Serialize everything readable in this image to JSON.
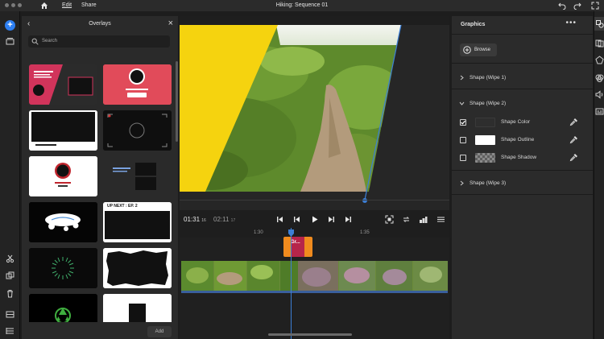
{
  "menubar": {
    "items": [
      "Edit",
      "Share"
    ],
    "title": "Hiking: Sequence 01",
    "icons": [
      "home-icon",
      "undo-icon",
      "redo-icon",
      "fullscreen-icon"
    ]
  },
  "left_rail": {
    "icons": [
      "add-icon",
      "media-icon",
      "cut-icon",
      "duplicate-icon",
      "trash-icon",
      "split-icon",
      "list-icon"
    ]
  },
  "overlays": {
    "title": "Overlays",
    "search_placeholder": "Search",
    "add_label": "Add",
    "tiles": [
      {
        "label": "Subscribe layout",
        "text": "",
        "accent": "#d1345b"
      },
      {
        "label": "Subscribe card",
        "text": "",
        "accent": "#e14b5a"
      },
      {
        "label": "Wide frame",
        "text": "",
        "accent": "#ffffff"
      },
      {
        "label": "Corner frame",
        "text": "",
        "accent": "#333333"
      },
      {
        "label": "Circle subscribe",
        "text": "",
        "accent": "#ffffff"
      },
      {
        "label": "Split screen",
        "text": "",
        "accent": "#2a2a2a"
      },
      {
        "label": "Logo splash",
        "text": "",
        "accent": "#000000"
      },
      {
        "label": "Up next",
        "text": "UP NEXT : EP. 2",
        "accent": "#ffffff"
      },
      {
        "label": "Radial burst",
        "text": "",
        "accent": "#0a0a0a"
      },
      {
        "label": "Torn paper",
        "text": "",
        "accent": "#ffffff"
      },
      {
        "label": "Recycle",
        "text": "",
        "accent": "#000000"
      },
      {
        "label": "Blank card",
        "text": "",
        "accent": "#ffffff"
      }
    ]
  },
  "player": {
    "current_time": "01:31",
    "current_frames": "16",
    "duration": "02:11",
    "duration_frames": "17",
    "controls": [
      "step-start-icon",
      "step-back-icon",
      "play-icon",
      "step-forward-icon",
      "step-end-icon"
    ],
    "right_controls": [
      "fit-icon",
      "loop-icon",
      "levels-icon",
      "menu-icon"
    ]
  },
  "timeline": {
    "ruler_ticks": [
      "1:30",
      "1:35"
    ],
    "graphic_clip_label": "Gr...",
    "playhead_time": "01:31:16"
  },
  "graphics_panel": {
    "title": "Graphics",
    "browse_label": "Browse",
    "sections": [
      {
        "label": "Shape (Wipe 1)",
        "expanded": false
      },
      {
        "label": "Shape (Wipe 2)",
        "expanded": true
      },
      {
        "label": "Shape (Wipe 3)",
        "expanded": false
      }
    ],
    "properties": [
      {
        "label": "Shape Color",
        "checked": true,
        "swatch": "#2e2e2e"
      },
      {
        "label": "Shape Outline",
        "checked": false,
        "swatch": "#ffffff"
      },
      {
        "label": "Shape Shadow",
        "checked": false,
        "swatch": "checker"
      }
    ]
  },
  "colors": {
    "accent": "#2d7ff2",
    "wipe_yellow": "#f5d30f",
    "graphic_clip": "#f08b1e",
    "graphic_clip_inner": "#b6254a",
    "playhead": "#3c7fd6"
  }
}
